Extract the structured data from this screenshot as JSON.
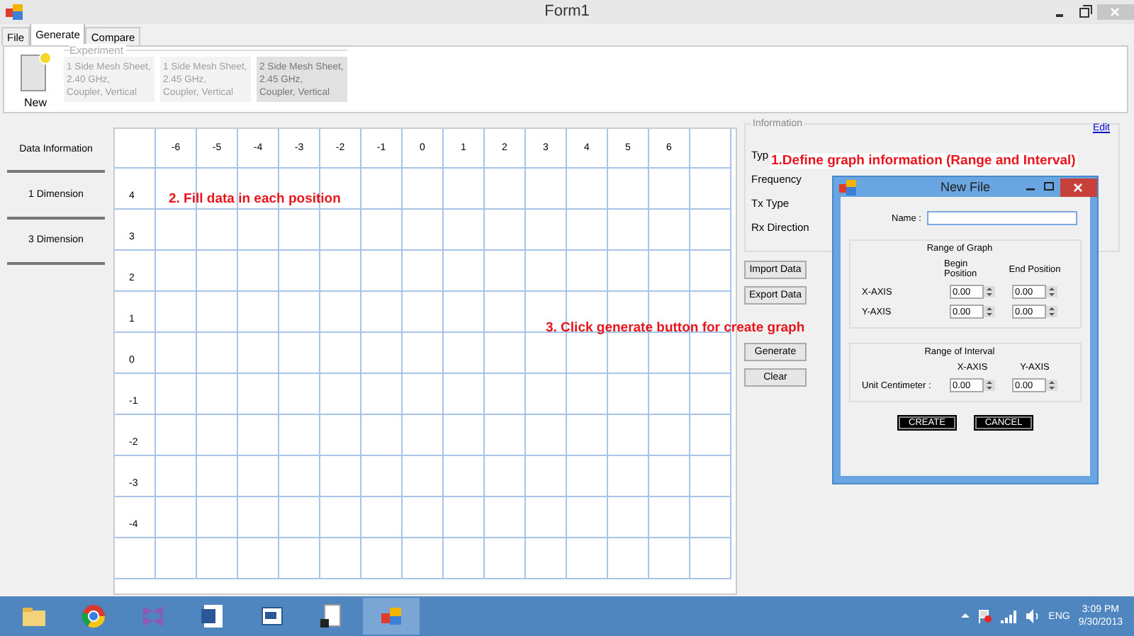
{
  "window": {
    "title": "Form1"
  },
  "tabs": [
    {
      "label": "File",
      "selected": false
    },
    {
      "label": "Generate",
      "selected": true
    },
    {
      "label": "Compare",
      "selected": false
    }
  ],
  "ribbon": {
    "new_button": "New",
    "group_title": "Experiment",
    "items": [
      {
        "lines": [
          "1 Side Mesh Sheet,",
          "2.40 GHz,",
          "Coupler, Vertical"
        ],
        "selected": false
      },
      {
        "lines": [
          "1 Side Mesh Sheet,",
          "2.45 GHz,",
          "Coupler, Vertical"
        ],
        "selected": false
      },
      {
        "lines": [
          "2 Side Mesh Sheet,",
          "2.45 GHz,",
          "Coupler, Vertical"
        ],
        "selected": true
      }
    ]
  },
  "sidebar": {
    "items": [
      {
        "label": "Data Information"
      },
      {
        "label": "1 Dimension"
      },
      {
        "label": "3 Dimension"
      }
    ]
  },
  "grid": {
    "columns": [
      "-6",
      "-5",
      "-4",
      "-3",
      "-2",
      "-1",
      "0",
      "1",
      "2",
      "3",
      "4",
      "5",
      "6"
    ],
    "rows": [
      "4",
      "3",
      "2",
      "1",
      "0",
      "-1",
      "-2",
      "-3",
      "-4"
    ]
  },
  "information": {
    "title": "Information",
    "edit_link": "Edit",
    "fields": [
      {
        "label": "Typ"
      },
      {
        "label": "Frequency"
      },
      {
        "label": "Tx Type"
      },
      {
        "label": "Rx Direction"
      }
    ],
    "buttons": [
      "Import Data",
      "Export Data",
      "Generate",
      "Clear"
    ]
  },
  "annotations": [
    "1.Define graph  information (Range and Interval)",
    "2. Fill data in each position",
    "3. Click generate button for create graph"
  ],
  "dialog": {
    "title": "New File",
    "name_label": "Name :",
    "graph_range": {
      "title": "Range of Graph",
      "headers": [
        "Begin Position",
        "End Position"
      ],
      "rows": [
        {
          "label": "X-AXIS",
          "values": [
            "0.00",
            "0.00"
          ]
        },
        {
          "label": "Y-AXIS",
          "values": [
            "0.00",
            "0.00"
          ]
        }
      ]
    },
    "interval_range": {
      "title": "Range of Interval",
      "headers": [
        "X-AXIS",
        "Y-AXIS"
      ],
      "rows": [
        {
          "label": "Unit Centimeter :",
          "values": [
            "0.00",
            "0.00"
          ]
        }
      ]
    },
    "buttons": [
      "CREATE",
      "CANCEL"
    ]
  },
  "taskbar": {
    "language": "ENG",
    "time": "3:09 PM",
    "date": "9/30/2013"
  }
}
